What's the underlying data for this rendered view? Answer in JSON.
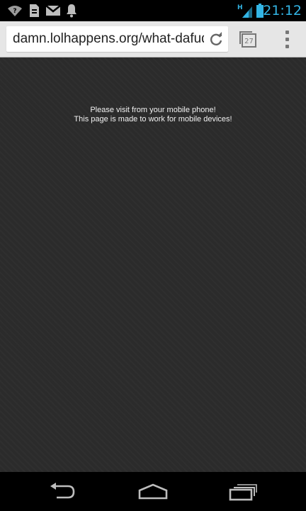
{
  "status_bar": {
    "time": "21:12",
    "network_type": "H",
    "icons": [
      "wifi-question-icon",
      "sd-card-icon",
      "gmail-icon",
      "notification-bell-icon",
      "signal-icon",
      "battery-icon"
    ]
  },
  "toolbar": {
    "url": "damn.lolhappens.org/what-dafuq-",
    "tab_count": "27"
  },
  "page": {
    "message_line1": "Please visit from your mobile phone!",
    "message_line2": "This page is made to work for mobile devices!"
  },
  "nav_bar": {
    "buttons": [
      "back-icon",
      "home-icon",
      "recent-apps-icon"
    ]
  },
  "colors": {
    "clock": "#33b5e5",
    "page_bg": "#2b2b2b",
    "toolbar_bg": "#e6e6e6"
  }
}
